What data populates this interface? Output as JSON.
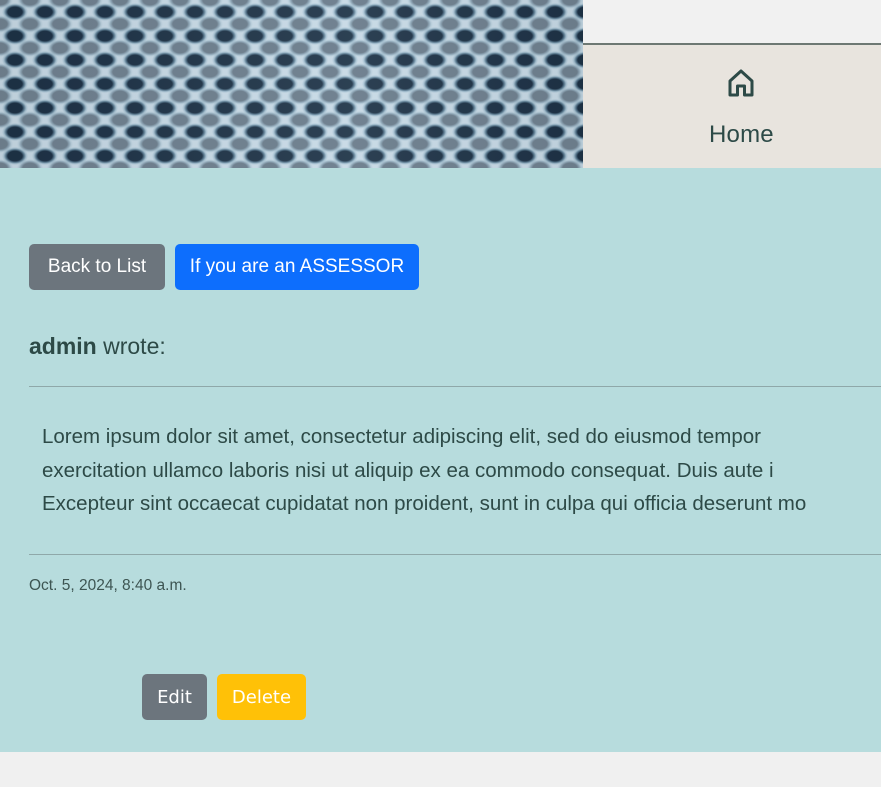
{
  "nav": {
    "home_label": "Home",
    "home_icon": "home-icon"
  },
  "hero": {
    "image": "honeycomb-mesh-texture"
  },
  "actions": {
    "back_label": "Back to List",
    "assessor_label": "If you are an ASSESSOR"
  },
  "post": {
    "author": "admin",
    "wrote_suffix": " wrote:",
    "body_lines": [
      "Lorem ipsum dolor sit amet, consectetur adipiscing elit, sed do eiusmod tempor",
      "exercitation ullamco laboris nisi ut aliquip ex ea commodo consequat. Duis aute i",
      "Excepteur sint occaecat cupidatat non proident, sunt in culpa qui officia deserunt mo"
    ],
    "timestamp": "Oct. 5, 2024, 8:40 a.m.",
    "edit_label": "Edit",
    "delete_label": "Delete"
  },
  "colors": {
    "content_bg": "#b7dcdd",
    "secondary": "#6c757d",
    "primary": "#0d6efd",
    "warning": "#ffc107",
    "text": "#2d4a47"
  }
}
